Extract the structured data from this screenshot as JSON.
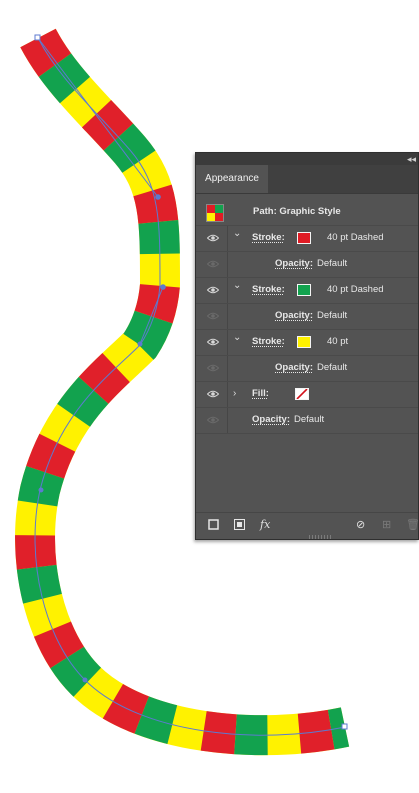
{
  "artwork": {
    "colors": {
      "red": "#e0202a",
      "green": "#12a24e",
      "yellow": "#fff200",
      "path": "#5c7ad0"
    }
  },
  "panel": {
    "tab_label": "Appearance",
    "header": {
      "title": "Path: Graphic Style",
      "icon": "graphic-style-thumbnail"
    },
    "rows": [
      {
        "kind": "stroke",
        "label": "Stroke:",
        "color": "#e01b24",
        "value": "40 pt Dashed",
        "eye_visible": true
      },
      {
        "kind": "opacity",
        "label": "Opacity:",
        "value": "Default",
        "eye_visible": false
      },
      {
        "kind": "stroke",
        "label": "Stroke:",
        "color": "#12a24e",
        "value": "40 pt Dashed",
        "eye_visible": true
      },
      {
        "kind": "opacity",
        "label": "Opacity:",
        "value": "Default",
        "eye_visible": false
      },
      {
        "kind": "stroke",
        "label": "Stroke:",
        "color": "#fff200",
        "value": "40 pt",
        "eye_visible": true
      },
      {
        "kind": "opacity",
        "label": "Opacity:",
        "value": "Default",
        "eye_visible": false
      },
      {
        "kind": "fill",
        "label": "Fill:",
        "color": "none",
        "value": "",
        "eye_visible": true
      },
      {
        "kind": "opacity",
        "label": "Opacity:",
        "value": "Default",
        "eye_visible": false
      }
    ],
    "toolbar": {
      "add_stroke": "add-new-stroke-icon",
      "add_fill": "add-new-fill-icon",
      "fx": "fx",
      "clear": "clear-appearance-icon",
      "duplicate": "duplicate-item-icon",
      "delete": "delete-item-icon"
    }
  }
}
